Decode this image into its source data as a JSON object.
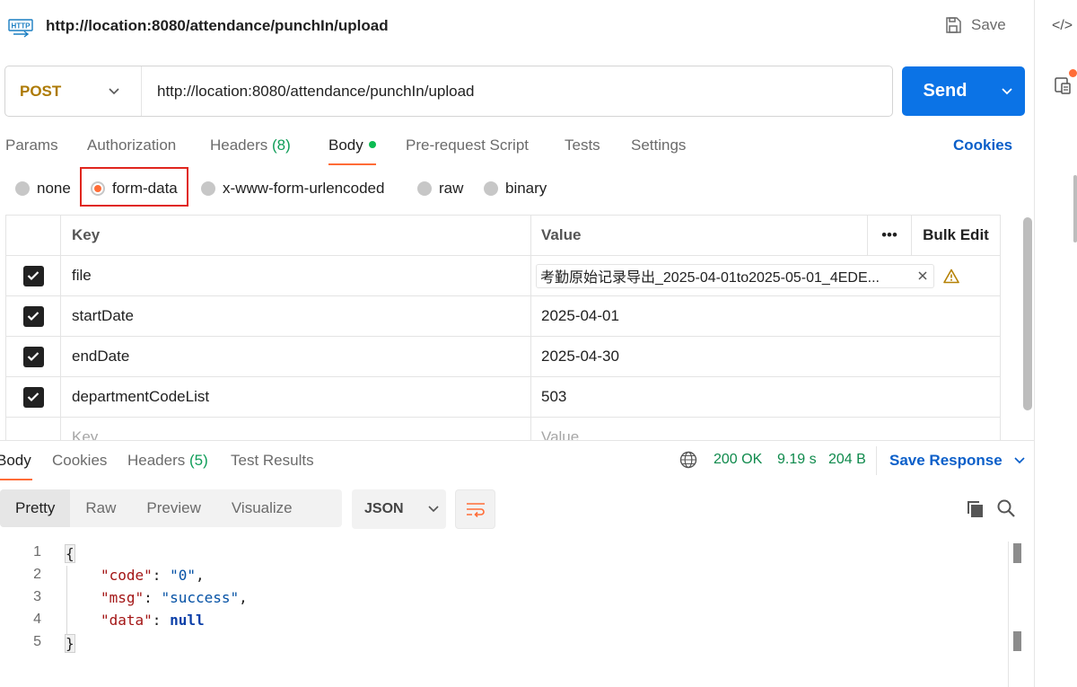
{
  "request": {
    "title": "http://location:8080/attendance/punchIn/upload",
    "save_label": "Save",
    "method": "POST",
    "url": "http://location:8080/attendance/punchIn/upload",
    "send_label": "Send",
    "http_badge": "HTTP"
  },
  "rail": {
    "code_icon": "</>"
  },
  "tabs": {
    "params": "Params",
    "authorization": "Authorization",
    "headers_label": "Headers",
    "headers_count": "(8)",
    "body": "Body",
    "prerequest": "Pre-request Script",
    "tests": "Tests",
    "settings": "Settings",
    "cookies": "Cookies"
  },
  "body_types": {
    "none": "none",
    "form_data": "form-data",
    "urlencoded": "x-www-form-urlencoded",
    "raw": "raw",
    "binary": "binary",
    "selected": "form-data"
  },
  "params_table": {
    "headers": {
      "key": "Key",
      "value": "Value",
      "more": "•••",
      "bulk_edit": "Bulk Edit"
    },
    "rows": [
      {
        "key": "file",
        "value": "考勤原始记录导出_2025-04-01to2025-05-01_4EDE...",
        "checked": true
      },
      {
        "key": "startDate",
        "value": "2025-04-01",
        "checked": true
      },
      {
        "key": "endDate",
        "value": "2025-04-30",
        "checked": true
      },
      {
        "key": "departmentCodeList",
        "value": "503",
        "checked": true
      }
    ],
    "new_row": {
      "key_placeholder": "Key",
      "value_placeholder": "Value"
    }
  },
  "response": {
    "tabs": {
      "body": "Body",
      "cookies": "Cookies",
      "headers_label": "Headers",
      "headers_count": "(5)",
      "test_results": "Test Results"
    },
    "status": "200 OK",
    "time": "9.19 s",
    "size": "204 B",
    "save_response": "Save Response",
    "views": {
      "pretty": "Pretty",
      "raw": "Raw",
      "preview": "Preview",
      "visualize": "Visualize"
    },
    "format": "JSON",
    "code": {
      "line_numbers": [
        "1",
        "2",
        "3",
        "4",
        "5"
      ],
      "open_brace": "{",
      "close_brace": "}",
      "code_key": "\"code\"",
      "code_value": "\"0\"",
      "msg_key": "\"msg\"",
      "msg_value": "\"success\"",
      "data_key": "\"data\"",
      "data_value": "null"
    }
  },
  "colors": {
    "accent": "#ff6c37",
    "send": "#0b73e6",
    "link": "#0b5fc9",
    "status_ok": "#0f8a4c",
    "method": "#ad7a03",
    "highlight": "#e0261e"
  }
}
